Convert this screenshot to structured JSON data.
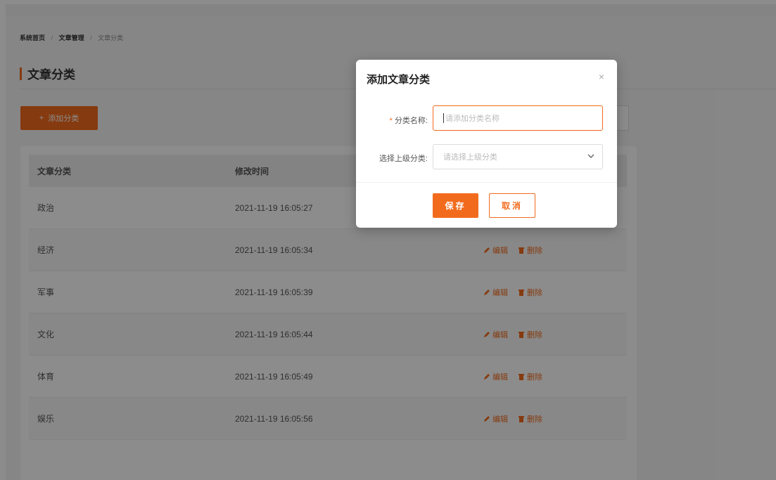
{
  "breadcrumb": {
    "home": "系统首页",
    "section": "文章管理",
    "current": "文章分类",
    "sep": "/"
  },
  "page": {
    "title": "文章分类",
    "add_button": "添加分类",
    "add_icon": "+"
  },
  "table": {
    "headers": [
      "文章分类",
      "修改时间"
    ],
    "rows": [
      {
        "category": "政治",
        "time": "2021-11-19 16:05:27"
      },
      {
        "category": "经济",
        "time": "2021-11-19 16:05:34"
      },
      {
        "category": "军事",
        "time": "2021-11-19 16:05:39"
      },
      {
        "category": "文化",
        "time": "2021-11-19 16:05:44"
      },
      {
        "category": "体育",
        "time": "2021-11-19 16:05:49"
      },
      {
        "category": "娱乐",
        "time": "2021-11-19 16:05:56"
      }
    ],
    "edit_label": "编辑",
    "delete_label": "删除"
  },
  "modal": {
    "title": "添加文章分类",
    "close": "×",
    "name_label": "分类名称:",
    "name_required": "*",
    "name_placeholder": "请添加分类名称",
    "parent_label": "选择上级分类:",
    "parent_placeholder": "请选择上级分类",
    "save": "保存",
    "cancel": "取消"
  },
  "colors": {
    "accent": "#f26b1d"
  },
  "icons": {
    "edit": "pencil-icon",
    "delete": "trash-icon",
    "select": "chevron-down-icon"
  }
}
